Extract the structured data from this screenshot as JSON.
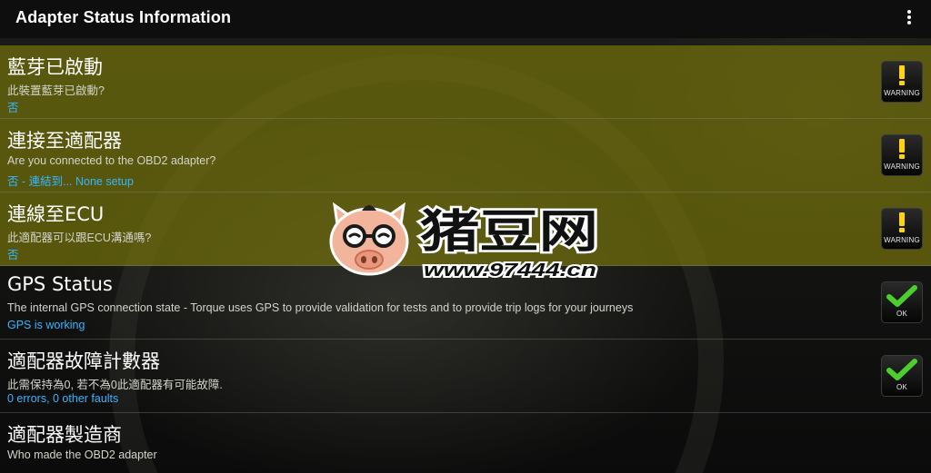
{
  "appbar": {
    "title": "Adapter Status Information",
    "menu_icon": "more-vert-icon"
  },
  "rows": [
    {
      "title": "藍芽已啟動",
      "description": "此裝置藍芽已啟動?",
      "status": "否",
      "badge": {
        "icon": "warning-exclamation-icon",
        "label": "WARNING",
        "color": "#ffd400"
      }
    },
    {
      "title": "連接至適配器",
      "description": "Are you connected to the OBD2 adapter?",
      "status": "否 - 連結到... None setup",
      "badge": {
        "icon": "warning-exclamation-icon",
        "label": "WARNING",
        "color": "#ffd400"
      }
    },
    {
      "title": "連線至ECU",
      "description": "此適配器可以跟ECU溝通嗎?",
      "status": "否",
      "badge": {
        "icon": "warning-exclamation-icon",
        "label": "WARNING",
        "color": "#ffd400"
      }
    },
    {
      "title": "GPS Status",
      "description": "The internal GPS connection state - Torque uses GPS to provide validation for tests and to provide trip logs for your journeys",
      "status": "GPS is working",
      "badge": {
        "icon": "ok-checkmark-icon",
        "label": "OK",
        "color": "#4ccf2c"
      }
    },
    {
      "title": "適配器故障計數器",
      "description": "此需保持為0, 若不為0此適配器有可能故障.",
      "status": "0 errors, 0 other faults",
      "badge": {
        "icon": "ok-checkmark-icon",
        "label": "OK",
        "color": "#4ccf2c"
      }
    },
    {
      "title": "適配器製造商",
      "description": "Who made the OBD2 adapter",
      "status": ""
    }
  ],
  "watermark": {
    "brand": "猪豆网",
    "url": "www.97444.cn",
    "mascot_icon": "pig-mascot-icon",
    "colors": {
      "text": "#111111",
      "outline": "#ffffff",
      "pig": "#f2b49a"
    }
  },
  "colors": {
    "warning_row": "#7a760a",
    "status_text": "#35b5ff",
    "appbar": "#0c0c0c"
  }
}
